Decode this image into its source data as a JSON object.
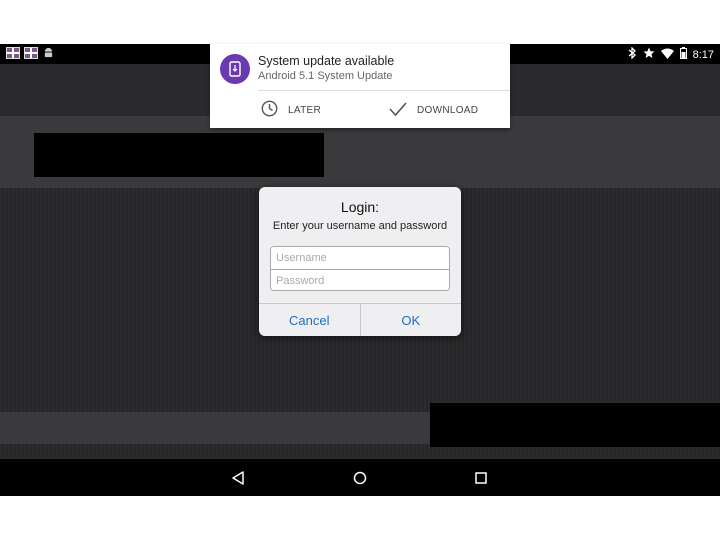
{
  "status_bar": {
    "left_icons": [
      "keyboard-flag-icon",
      "keyboard-flag-icon",
      "android-debug-icon"
    ],
    "right_icons": [
      "bluetooth-icon",
      "star-icon",
      "wifi-icon",
      "battery-icon"
    ],
    "time": "8:17"
  },
  "notification": {
    "icon": "system-update-icon",
    "icon_color": "#6a3bb0",
    "title": "System update available",
    "subtitle": "Android 5.1 System Update",
    "actions": [
      {
        "icon": "clock-icon",
        "label": "LATER"
      },
      {
        "icon": "check-icon",
        "label": "DOWNLOAD"
      }
    ]
  },
  "dialog": {
    "title": "Login:",
    "message": "Enter your username and password",
    "username_placeholder": "Username",
    "username_value": "",
    "password_placeholder": "Password",
    "password_value": "",
    "cancel_label": "Cancel",
    "ok_label": "OK",
    "button_color": "#1f6fc4"
  },
  "nav_bar": {
    "buttons": [
      "back-icon",
      "home-icon",
      "recents-icon"
    ]
  }
}
